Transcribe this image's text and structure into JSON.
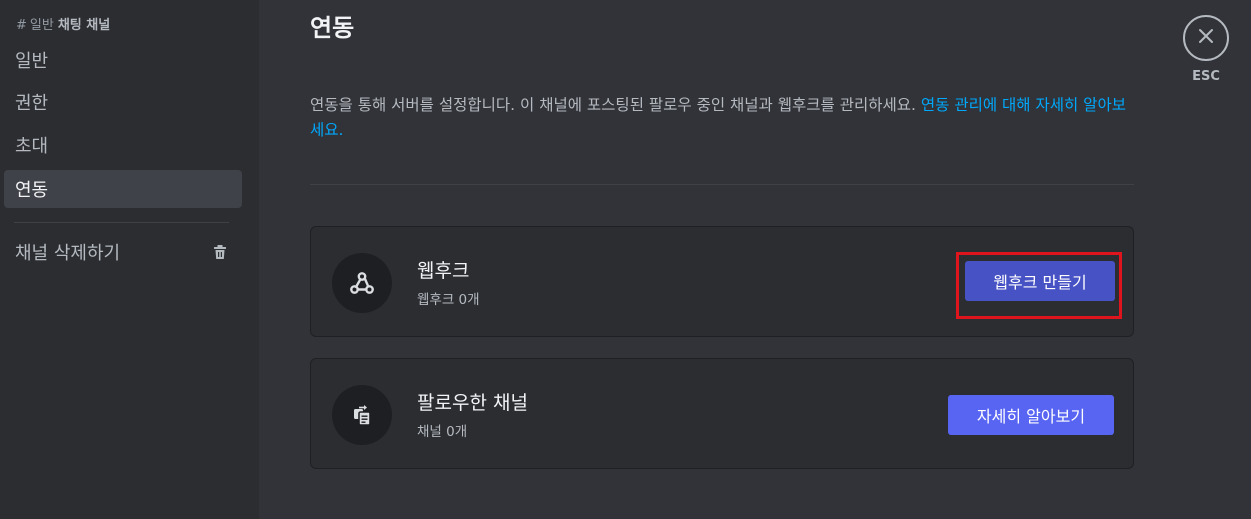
{
  "sidebar": {
    "header": {
      "hash": "#",
      "category": "일반",
      "channel": "채팅 채널"
    },
    "items": [
      {
        "label": "일반"
      },
      {
        "label": "권한"
      },
      {
        "label": "초대"
      },
      {
        "label": "연동"
      }
    ],
    "active_item": "연동",
    "delete_label": "채널 삭제하기",
    "delete_icon": "trash-icon"
  },
  "main": {
    "title": "연동",
    "description": "연동을 통해 서버를 설정합니다. 이 채널에 포스팅된 팔로우 중인 채널과 웹후크를 관리하세요.",
    "description_link": "연동 관리에 대해 자세히 알아보세요.",
    "cards": [
      {
        "icon": "webhook-icon",
        "title": "웹후크",
        "subtitle": "웹후크 0개",
        "button": "웹후크 만들기"
      },
      {
        "icon": "followed-channel-icon",
        "title": "팔로우한 채널",
        "subtitle": "채널 0개",
        "button": "자세히 알아보기"
      }
    ]
  },
  "close": {
    "icon": "close-icon",
    "label": "ESC"
  },
  "colors": {
    "background": "#313338",
    "sidebar": "#2b2d31",
    "accent": "#5865f2",
    "link": "#00a8fc",
    "highlight": "#e0141c"
  }
}
